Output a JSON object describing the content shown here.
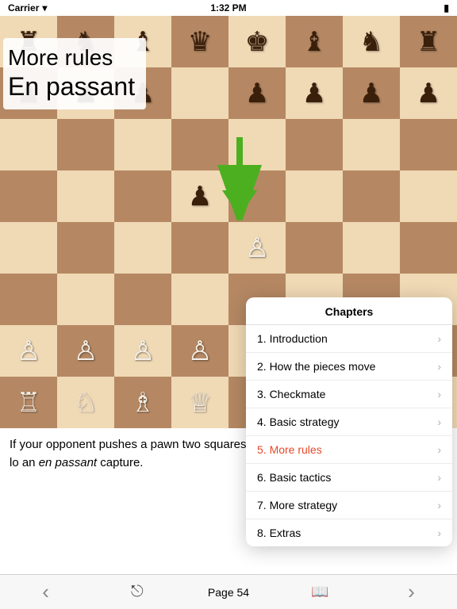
{
  "statusBar": {
    "carrier": "Carrier",
    "time": "1:32 PM",
    "wifi": "wifi",
    "battery": "battery"
  },
  "boardOverlay": {
    "title": "More rules",
    "subtitle": "En passant"
  },
  "bottomText": "If your opponent pushes a pawn two squares, and you can capture it en passant. lo an en passant capture.",
  "chapters": {
    "header": "Chapters",
    "items": [
      {
        "id": 1,
        "label": "1. Introduction",
        "active": false
      },
      {
        "id": 2,
        "label": "2. How the pieces move",
        "active": false
      },
      {
        "id": 3,
        "label": "3. Checkmate",
        "active": false
      },
      {
        "id": 4,
        "label": "4. Basic strategy",
        "active": false
      },
      {
        "id": 5,
        "label": "5. More rules",
        "active": true
      },
      {
        "id": 6,
        "label": "6. Basic tactics",
        "active": false
      },
      {
        "id": 7,
        "label": "7. More strategy",
        "active": false
      },
      {
        "id": 8,
        "label": "8. Extras",
        "active": false
      }
    ]
  },
  "bottomNav": {
    "pageLabel": "Page 54",
    "prevLabel": "‹",
    "nextLabel": "›"
  },
  "board": {
    "rows": 8,
    "cols": 8
  }
}
